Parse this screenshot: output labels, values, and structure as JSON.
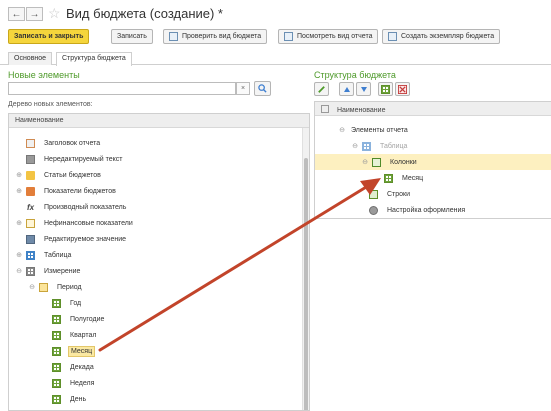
{
  "window": {
    "title": "Вид бюджета (создание) *"
  },
  "toolbar": {
    "save_close": "Записать и закрыть",
    "save": "Записать",
    "check": "Проверить вид бюджета",
    "view_report": "Посмотреть вид отчета",
    "create_instance": "Создать экземпляр бюджета"
  },
  "tabs": [
    "Основное",
    "Структура бюджета"
  ],
  "left": {
    "title": "Новые элементы",
    "search_value": "",
    "search_clear": "×",
    "tree_label": "Дерево новых элементов:",
    "column": "Наименование",
    "items": [
      {
        "label": "Заголовок отчета",
        "icon": "report-header-icon"
      },
      {
        "label": "Нередактируемый текст",
        "icon": "text-icon"
      },
      {
        "label": "Статьи бюджетов",
        "icon": "folder-icon",
        "expand": "⊕"
      },
      {
        "label": "Показатели бюджетов",
        "icon": "folder-icon",
        "expand": "⊕"
      },
      {
        "label": "Производный показатель",
        "icon": "fx-icon"
      },
      {
        "label": "Нефинансовые показатели",
        "icon": "folder-outline-icon",
        "expand": "⊕"
      },
      {
        "label": "Редактируемое значение",
        "icon": "edit-value-icon"
      },
      {
        "label": "Таблица",
        "icon": "table-icon",
        "expand": "⊕"
      },
      {
        "label": "Измерение",
        "icon": "dimension-icon",
        "expand": "⊖"
      },
      {
        "label": "Период",
        "icon": "period-folder-icon",
        "expand": "⊖"
      },
      {
        "label": "Год",
        "icon": "grid-icon"
      },
      {
        "label": "Полугодие",
        "icon": "grid-icon"
      },
      {
        "label": "Квартал",
        "icon": "grid-icon"
      },
      {
        "label": "Месяц",
        "icon": "grid-icon",
        "selected": true
      },
      {
        "label": "Декада",
        "icon": "grid-icon"
      },
      {
        "label": "Неделя",
        "icon": "grid-icon"
      },
      {
        "label": "День",
        "icon": "grid-icon"
      }
    ]
  },
  "right": {
    "title": "Структура бюджета",
    "column": "Наименование",
    "items": [
      {
        "label": "Элементы отчета",
        "expand": "⊖"
      },
      {
        "label": "Таблица",
        "expand": "⊖",
        "muted": true
      },
      {
        "label": "Колонки",
        "expand": "⊖",
        "selected": true
      },
      {
        "label": "Месяц"
      },
      {
        "label": "Строки"
      },
      {
        "label": "Настройка оформления"
      }
    ]
  },
  "colors": {
    "accent_green": "#4e9a2a",
    "primary_button": "#f5d53c",
    "selection": "#fbe9a2",
    "arrow": "#c2442a"
  }
}
